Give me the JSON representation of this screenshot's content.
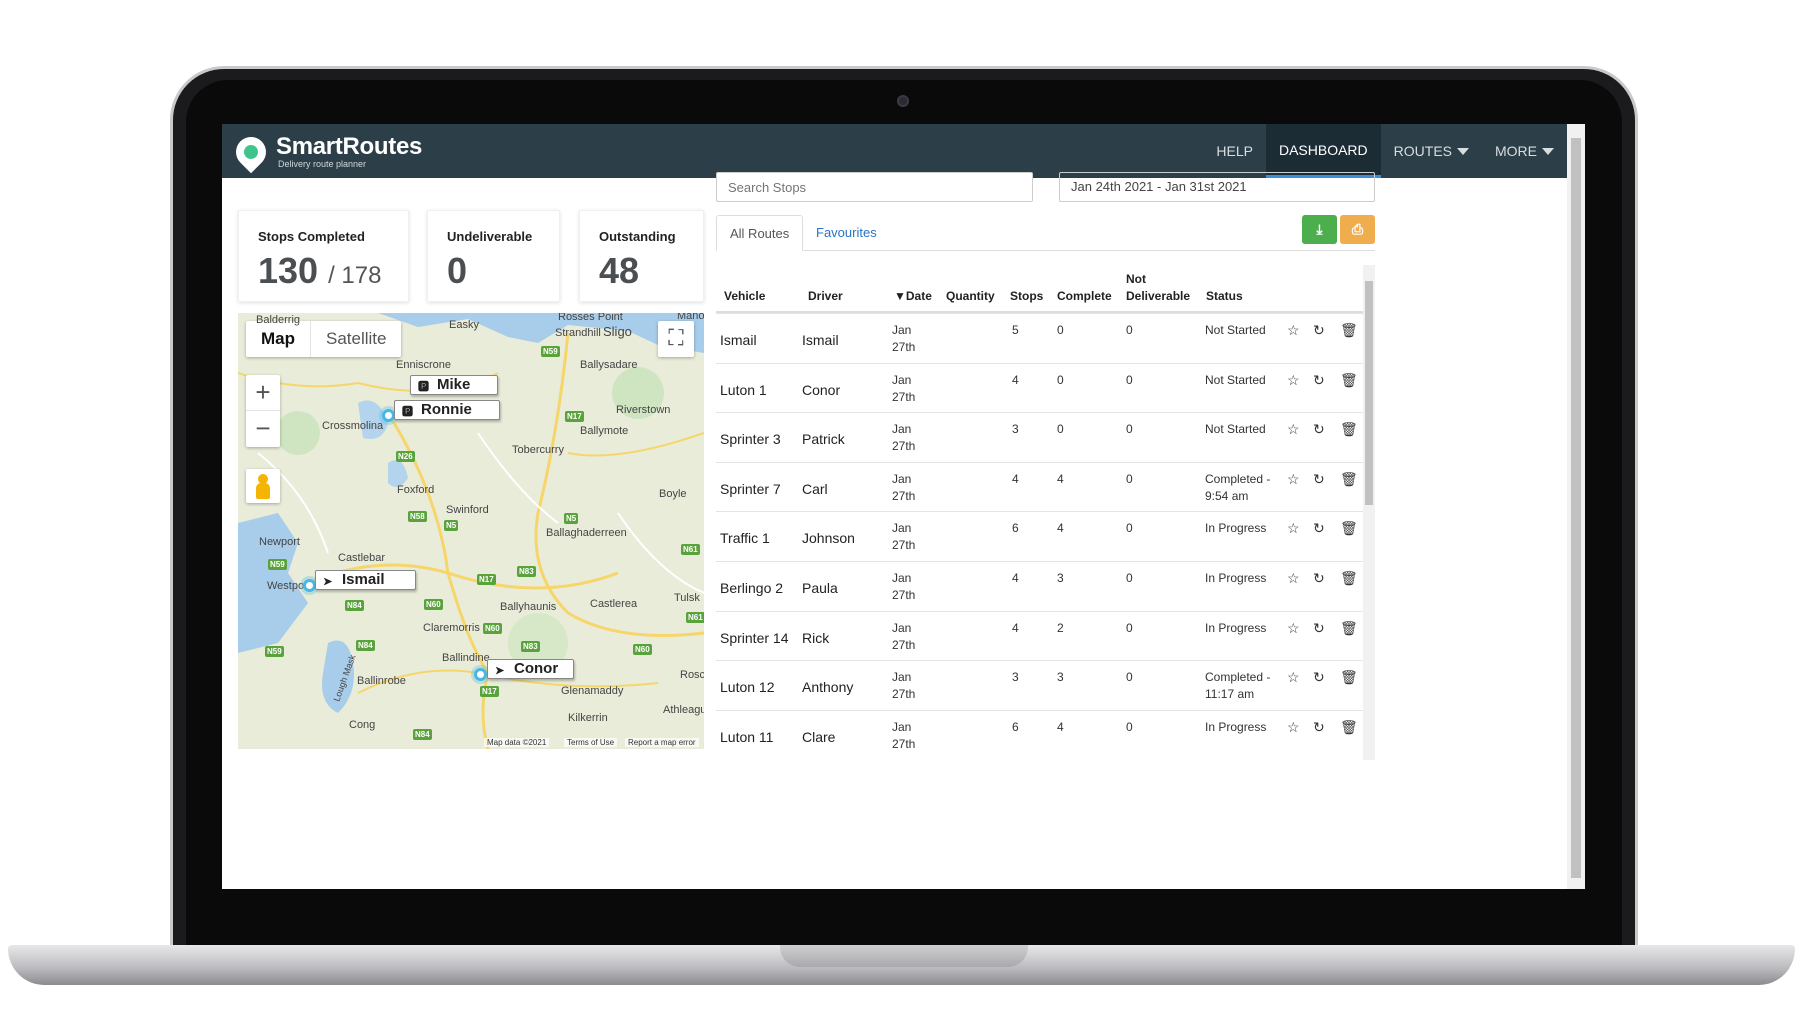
{
  "brand": {
    "name": "SmartRoutes",
    "tagline": "Delivery route planner"
  },
  "nav": {
    "help": "HELP",
    "dashboard": "DASHBOARD",
    "routes": "ROUTES",
    "more": "MORE"
  },
  "cards": {
    "stops_completed": {
      "label": "Stops Completed",
      "value": "130",
      "total": "/ 178"
    },
    "undeliverable": {
      "label": "Undeliverable",
      "value": "0"
    },
    "outstanding": {
      "label": "Outstanding",
      "value": "48"
    }
  },
  "map": {
    "type_map": "Map",
    "type_satellite": "Satellite",
    "zoom_in": "+",
    "zoom_out": "−",
    "places": [
      "Easky",
      "Rosses Point",
      "Strandhill",
      "Sligo",
      "Enniscrone",
      "Ballysadare",
      "Crossmolina",
      "Riverstown",
      "Ballymote",
      "Tobercurry",
      "Foxford",
      "Boyle",
      "Swinford",
      "Newport",
      "Castlebar",
      "Ballaghaderreen",
      "Westport",
      "Castlerea",
      "Tulsk",
      "Ballyhaunis",
      "Claremorris",
      "Ballindine",
      "Ballinrobe",
      "Glenamaddy",
      "Roscommon",
      "Kilkerrin",
      "Athleague",
      "Cong",
      "Lough Mask",
      "Manorhamilton",
      "Balderrig"
    ],
    "roads": [
      "N59",
      "N17",
      "N26",
      "N58",
      "N5",
      "N5",
      "N59",
      "N84",
      "N60",
      "N83",
      "N61",
      "N17",
      "N83",
      "N60",
      "N60",
      "N59",
      "N84",
      "N17",
      "N84",
      "N61"
    ],
    "drivers": [
      "Mike",
      "Ronnie",
      "Ismail",
      "Conor"
    ],
    "footer": {
      "map_data": "Map data ©2021",
      "terms": "Terms of Use",
      "report": "Report a map error"
    }
  },
  "search": {
    "placeholder": "Search Stops"
  },
  "date_range": "Jan 24th 2021 - Jan 31st 2021",
  "tabs": {
    "all_routes": "All Routes",
    "favourites": "Favourites"
  },
  "buttons": {
    "download_icon": "download-icon",
    "print_icon": "print-icon"
  },
  "table": {
    "headers": {
      "vehicle": "Vehicle",
      "driver": "Driver",
      "date": "▼Date",
      "quantity": "Quantity",
      "stops": "Stops",
      "complete": "Complete",
      "not_deliverable_1": "Not",
      "not_deliverable_2": "Deliverable",
      "status": "Status"
    },
    "rows": [
      {
        "vehicle": "Ismail",
        "driver": "Ismail",
        "date_1": "Jan",
        "date_2": "27th",
        "stops": "5",
        "complete": "0",
        "not_deliverable": "0",
        "status_1": "Not Started",
        "status_2": ""
      },
      {
        "vehicle": "Luton 1",
        "driver": "Conor",
        "date_1": "Jan",
        "date_2": "27th",
        "stops": "4",
        "complete": "0",
        "not_deliverable": "0",
        "status_1": "Not Started",
        "status_2": ""
      },
      {
        "vehicle": "Sprinter 3",
        "driver": "Patrick",
        "date_1": "Jan",
        "date_2": "27th",
        "stops": "3",
        "complete": "0",
        "not_deliverable": "0",
        "status_1": "Not Started",
        "status_2": ""
      },
      {
        "vehicle": "Sprinter 7",
        "driver": "Carl",
        "date_1": "Jan",
        "date_2": "27th",
        "stops": "4",
        "complete": "4",
        "not_deliverable": "0",
        "status_1": "Completed -",
        "status_2": "9:54 am"
      },
      {
        "vehicle": "Traffic 1",
        "driver": "Johnson",
        "date_1": "Jan",
        "date_2": "27th",
        "stops": "6",
        "complete": "4",
        "not_deliverable": "0",
        "status_1": "In Progress",
        "status_2": ""
      },
      {
        "vehicle": "Berlingo 2",
        "driver": "Paula",
        "date_1": "Jan",
        "date_2": "27th",
        "stops": "4",
        "complete": "3",
        "not_deliverable": "0",
        "status_1": "In Progress",
        "status_2": ""
      },
      {
        "vehicle": "Sprinter 14",
        "driver": "Rick",
        "date_1": "Jan",
        "date_2": "27th",
        "stops": "4",
        "complete": "2",
        "not_deliverable": "0",
        "status_1": "In Progress",
        "status_2": ""
      },
      {
        "vehicle": "Luton 12",
        "driver": "Anthony",
        "date_1": "Jan",
        "date_2": "27th",
        "stops": "3",
        "complete": "3",
        "not_deliverable": "0",
        "status_1": "Completed -",
        "status_2": "11:17 am"
      },
      {
        "vehicle": "Luton 11",
        "driver": "Clare",
        "date_1": "Jan",
        "date_2": "27th",
        "stops": "6",
        "complete": "4",
        "not_deliverable": "0",
        "status_1": "In Progress",
        "status_2": ""
      }
    ],
    "row_icons": [
      "star-icon",
      "refresh-icon",
      "trash-icon"
    ]
  },
  "colors": {
    "navbar": "#2c3e48",
    "active_tab_underline": "#3b8fd6",
    "download_button": "#4cae4c",
    "print_button": "#f0ad4e",
    "marker": "#49b7e6"
  }
}
